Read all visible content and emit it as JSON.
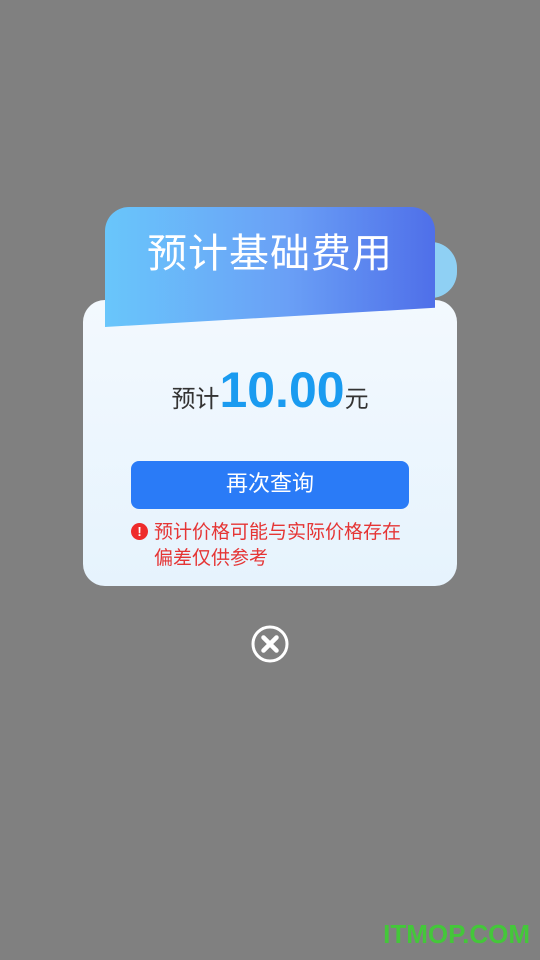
{
  "dialog": {
    "title": "预计基础费用",
    "price": {
      "prefix": "预计",
      "amount": "10.00",
      "unit": "元"
    },
    "requery_label": "再次查询",
    "notice_icon": "exclamation-icon",
    "notice_text": "预计价格可能与实际价格存在偏差仅供参考",
    "close_icon": "close-circle-icon"
  },
  "watermark": "ITMOP.COM",
  "colors": {
    "overlay": "#808080",
    "header_start": "#69c6fb",
    "header_end": "#4f6fe9",
    "price_amount": "#1a9bf0",
    "button": "#2a7bf7",
    "notice": "#e53535",
    "watermark": "#44c73a"
  }
}
